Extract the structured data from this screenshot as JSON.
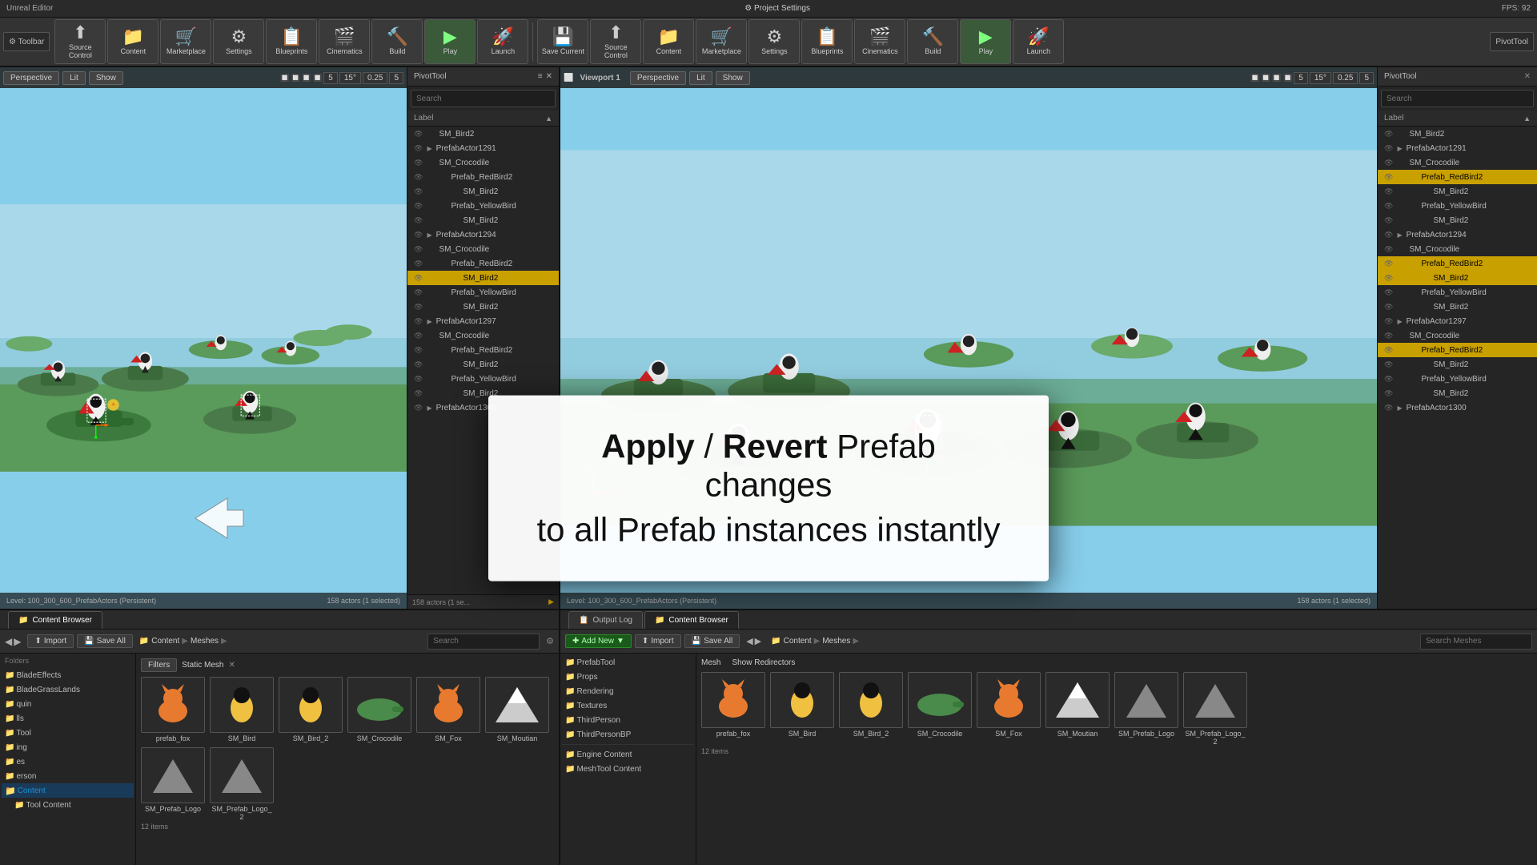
{
  "window": {
    "title": "Unreal Editor",
    "fps": "FPS: 92"
  },
  "toolbar": {
    "left": {
      "buttons": [
        {
          "id": "source-control",
          "label": "Source Control",
          "icon": "⬆"
        },
        {
          "id": "content",
          "label": "Content",
          "icon": "📁"
        },
        {
          "id": "marketplace",
          "label": "Marketplace",
          "icon": "🛒"
        },
        {
          "id": "settings",
          "label": "Settings",
          "icon": "⚙"
        },
        {
          "id": "blueprints",
          "label": "Blueprints",
          "icon": "📋"
        },
        {
          "id": "cinematics",
          "label": "Cinematics",
          "icon": "🎬"
        },
        {
          "id": "build",
          "label": "Build",
          "icon": "🔧"
        },
        {
          "id": "play",
          "label": "Play",
          "icon": "▶"
        },
        {
          "id": "launch",
          "label": "Launch",
          "icon": "🚀"
        }
      ]
    },
    "right": {
      "buttons": [
        {
          "id": "save-current",
          "label": "Save Current",
          "icon": "💾"
        },
        {
          "id": "source-control-r",
          "label": "Source Control",
          "icon": "⬆"
        },
        {
          "id": "content-r",
          "label": "Content",
          "icon": "📁"
        },
        {
          "id": "marketplace-r",
          "label": "Marketplace",
          "icon": "🛒"
        },
        {
          "id": "settings-r",
          "label": "Settings",
          "icon": "⚙"
        },
        {
          "id": "blueprints-r",
          "label": "Blueprints",
          "icon": "📋"
        },
        {
          "id": "cinematics-r",
          "label": "Cinematics",
          "icon": "🎬"
        },
        {
          "id": "build-r",
          "label": "Build",
          "icon": "🔧"
        },
        {
          "id": "play-r",
          "label": "Play",
          "icon": "▶"
        },
        {
          "id": "launch-r",
          "label": "Launch",
          "icon": "🚀"
        }
      ]
    }
  },
  "left_viewport": {
    "mode": "Perspective",
    "lit": "Lit",
    "show": "Show",
    "status": "Level: 100_300_600_PrefabActors (Persistent)",
    "actors": "158 actors (1 selected)"
  },
  "right_viewport": {
    "panel_title": "Viewport 1",
    "mode": "Perspective",
    "lit": "Lit",
    "show": "Show",
    "status": "Level: 100_300_600_PrefabActors (Persistent)",
    "actors": "158 actors (1 selected)"
  },
  "pivot_tool": {
    "title": "PivotTool",
    "search_placeholder": "Search"
  },
  "outliner": {
    "label_header": "Label",
    "items": [
      {
        "name": "SM_Bird2",
        "depth": 1,
        "selected": false
      },
      {
        "name": "PrefabActor1291",
        "depth": 0,
        "selected": false
      },
      {
        "name": "SM_Crocodile",
        "depth": 1,
        "selected": false
      },
      {
        "name": "Prefab_RedBird2",
        "depth": 2,
        "selected": false
      },
      {
        "name": "SM_Bird2",
        "depth": 3,
        "selected": false
      },
      {
        "name": "Prefab_YellowBird",
        "depth": 2,
        "selected": false
      },
      {
        "name": "SM_Bird2",
        "depth": 3,
        "selected": false
      },
      {
        "name": "PrefabActor1294",
        "depth": 0,
        "selected": false
      },
      {
        "name": "SM_Crocodile",
        "depth": 1,
        "selected": false
      },
      {
        "name": "Prefab_RedBird2",
        "depth": 2,
        "selected": false
      },
      {
        "name": "SM_Bird2",
        "depth": 3,
        "selected": true
      },
      {
        "name": "Prefab_YellowBird",
        "depth": 2,
        "selected": false
      },
      {
        "name": "SM_Bird2",
        "depth": 3,
        "selected": false
      },
      {
        "name": "PrefabActor1297",
        "depth": 0,
        "selected": false
      },
      {
        "name": "SM_Crocodile",
        "depth": 1,
        "selected": false
      },
      {
        "name": "Prefab_RedBird2",
        "depth": 2,
        "selected": false
      },
      {
        "name": "SM_Bird2",
        "depth": 3,
        "selected": false
      },
      {
        "name": "Prefab_YellowBird",
        "depth": 2,
        "selected": false
      },
      {
        "name": "SM_Bird2",
        "depth": 3,
        "selected": false
      },
      {
        "name": "PrefabActor1300",
        "depth": 0,
        "selected": false
      }
    ]
  },
  "content_browser_left": {
    "title": "Content Browser",
    "import_label": "Import",
    "save_all_label": "Save All",
    "path": [
      "Content",
      "Meshes"
    ],
    "search_placeholder": "Search",
    "filter_label": "Filters",
    "filter_type": "Static Mesh",
    "folders": [
      {
        "name": "BladeEffects",
        "depth": 0
      },
      {
        "name": "BladeGrassLands",
        "depth": 0
      },
      {
        "name": "quin",
        "depth": 0
      },
      {
        "name": "lls",
        "depth": 0
      },
      {
        "name": "Tool",
        "depth": 0
      },
      {
        "name": "ing",
        "depth": 0
      },
      {
        "name": "es",
        "depth": 0
      },
      {
        "name": "erson",
        "depth": 0
      },
      {
        "name": "Content",
        "depth": 0,
        "selected": true
      },
      {
        "name": "Tool Content",
        "depth": 1
      }
    ],
    "assets": [
      {
        "name": "prefab_fox",
        "color": "#e87a30"
      },
      {
        "name": "SM_Bird",
        "color": "#f0c040"
      },
      {
        "name": "SM_Bird_2",
        "color": "#f0c040"
      },
      {
        "name": "SM_Crocodile",
        "color": "#4a8a4a"
      },
      {
        "name": "SM_Fox",
        "color": "#e87a30"
      }
    ],
    "asset_count": "12 items",
    "assets_row2": [
      {
        "name": "SM_Moutian",
        "color": "#aaa"
      },
      {
        "name": "SM_Prefab_Logo",
        "color": "#aaa"
      },
      {
        "name": "SM_Prefab_Logo_2",
        "color": "#aaa"
      }
    ]
  },
  "content_browser_right": {
    "title": "Content Browser",
    "add_new_label": "Add New",
    "import_label": "Import",
    "save_all_label": "Save All",
    "path": [
      "Content",
      "Meshes"
    ],
    "search_placeholder": "Search Meshes",
    "filter_type": "Mesh",
    "show_redirectors": "Show Redirectors",
    "folders": [
      {
        "name": "PrefabTool",
        "depth": 0
      },
      {
        "name": "Props",
        "depth": 0
      },
      {
        "name": "Rendering",
        "depth": 0
      },
      {
        "name": "Textures",
        "depth": 0
      },
      {
        "name": "ThirdPerson",
        "depth": 0
      },
      {
        "name": "ThirdPersonBP",
        "depth": 0
      }
    ],
    "engine_folders": [
      {
        "name": "Engine Content",
        "depth": 0
      },
      {
        "name": "MeshTool Content",
        "depth": 0
      }
    ],
    "assets": [
      {
        "name": "prefab_fox",
        "color": "#e87a30"
      },
      {
        "name": "SM_Bird",
        "color": "#f0c040"
      },
      {
        "name": "SM_Bird_2",
        "color": "#f0c040"
      },
      {
        "name": "SM_Crocodile",
        "color": "#4a8a4a"
      },
      {
        "name": "SM_Fox",
        "color": "#e87a30"
      }
    ],
    "asset_count": "12 items",
    "assets_row2": [
      {
        "name": "SM_Moutian",
        "color": "#aaa"
      },
      {
        "name": "SM_Prefab_Logo",
        "color": "#aaa"
      },
      {
        "name": "SM_Prefab_Logo_2",
        "color": "#aaa"
      }
    ]
  },
  "output_log": {
    "title": "Output Log"
  },
  "overlay": {
    "line1_normal": " / ",
    "line1_bold1": "Apply",
    "line1_bold2": "Revert",
    "line1_rest": " Prefab changes",
    "line2": "to all Prefab instances instantly"
  },
  "colors": {
    "accent_gold": "#c8a000",
    "accent_blue": "#1a5a8a",
    "bg_dark": "#252525",
    "bg_toolbar": "#333",
    "selected_row": "#c8a000"
  }
}
